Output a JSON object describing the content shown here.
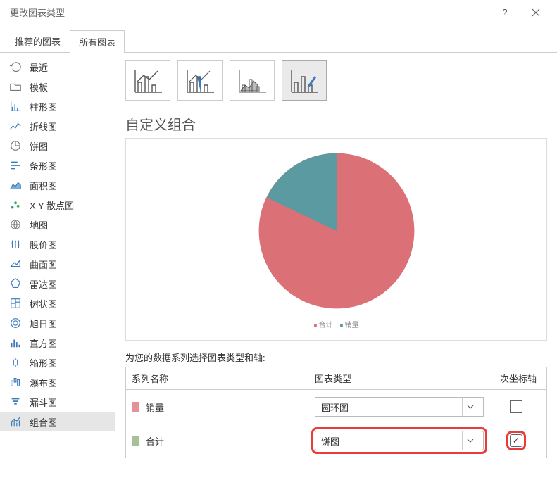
{
  "window": {
    "title": "更改图表类型"
  },
  "tabs": [
    {
      "label": "推荐的图表"
    },
    {
      "label": "所有图表"
    }
  ],
  "sidebar": {
    "items": [
      {
        "label": "最近"
      },
      {
        "label": "模板"
      },
      {
        "label": "柱形图"
      },
      {
        "label": "折线图"
      },
      {
        "label": "饼图"
      },
      {
        "label": "条形图"
      },
      {
        "label": "面积图"
      },
      {
        "label": "X Y 散点图"
      },
      {
        "label": "地图"
      },
      {
        "label": "股价图"
      },
      {
        "label": "曲面图"
      },
      {
        "label": "雷达图"
      },
      {
        "label": "树状图"
      },
      {
        "label": "旭日图"
      },
      {
        "label": "直方图"
      },
      {
        "label": "箱形图"
      },
      {
        "label": "瀑布图"
      },
      {
        "label": "漏斗图"
      },
      {
        "label": "组合图"
      }
    ]
  },
  "main": {
    "section_title": "自定义组合",
    "series_prompt": "为您的数据系列选择图表类型和轴:",
    "header": {
      "name": "系列名称",
      "type": "图表类型",
      "axis": "次坐标轴"
    },
    "legend": {
      "total": "合计",
      "sales": "销量"
    },
    "series": [
      {
        "name": "销量",
        "type": "圆环图",
        "secondary": false,
        "swatch": "pink"
      },
      {
        "name": "合计",
        "type": "饼图",
        "secondary": true,
        "swatch": "green"
      }
    ]
  },
  "chart_data": {
    "type": "pie",
    "title": "",
    "series": [
      {
        "name": "合计",
        "value": 83,
        "color": "#db7077"
      },
      {
        "name": "销量",
        "value": 17,
        "color": "#5b9aa0"
      }
    ]
  }
}
